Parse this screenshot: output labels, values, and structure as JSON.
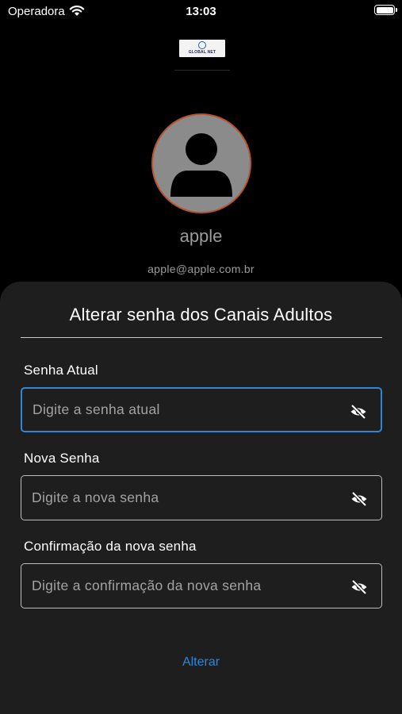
{
  "status_bar": {
    "carrier": "Operadora",
    "time": "13:03"
  },
  "brand": {
    "logo_text": "GLOBAL NET"
  },
  "profile": {
    "name": "apple",
    "email": "apple@apple.com.br"
  },
  "sheet": {
    "title": "Alterar senha dos Canais Adultos",
    "fields": [
      {
        "label": "Senha Atual",
        "placeholder": "Digite a senha atual",
        "value": ""
      },
      {
        "label": "Nova Senha",
        "placeholder": "Digite a nova senha",
        "value": ""
      },
      {
        "label": "Confirmação da nova senha",
        "placeholder": "Digite a confirmação da nova senha",
        "value": ""
      }
    ],
    "submit_label": "Alterar"
  },
  "colors": {
    "background": "#000000",
    "sheet": "#1e1e1e",
    "accent": "#2f86d6",
    "avatar_border": "#b9532f",
    "avatar_fill": "#8b8b8b",
    "muted_text": "#9b9b9b"
  }
}
